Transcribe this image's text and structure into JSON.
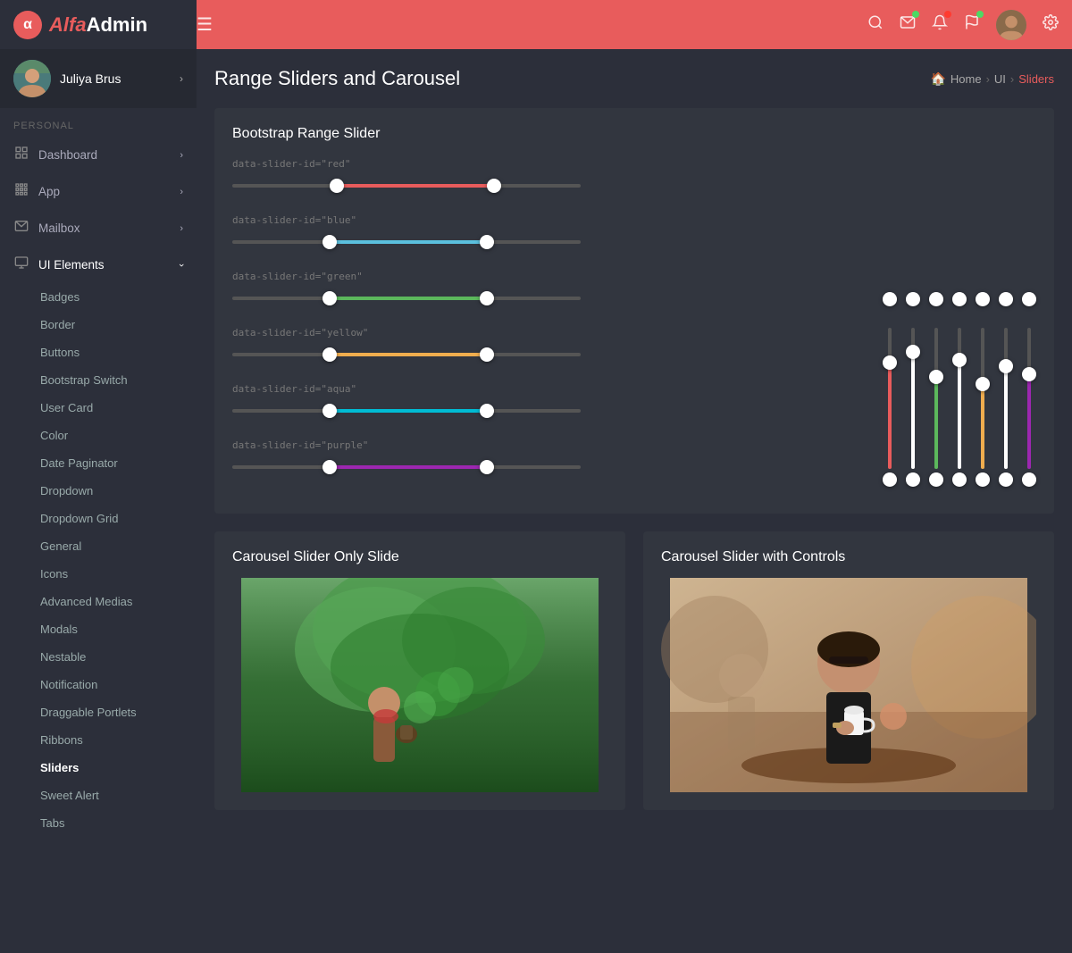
{
  "brand": {
    "alpha": "Alfa",
    "admin": "Admin",
    "logo_letter": "α"
  },
  "navbar": {
    "hamburger": "☰",
    "search_icon": "🔍",
    "mail_icon": "✉",
    "bell_icon": "🔔",
    "flag_icon": "⚑",
    "gear_icon": "⚙"
  },
  "user": {
    "name": "Juliya Brus"
  },
  "sidebar": {
    "section_personal": "PERSONAL",
    "items": [
      {
        "id": "dashboard",
        "label": "Dashboard",
        "icon": "⊞",
        "has_arrow": true
      },
      {
        "id": "app",
        "label": "App",
        "icon": "⊟",
        "has_arrow": true
      },
      {
        "id": "mailbox",
        "label": "Mailbox",
        "icon": "✉",
        "has_arrow": true
      },
      {
        "id": "ui-elements",
        "label": "UI Elements",
        "icon": "▭",
        "has_arrow": true,
        "active": true
      }
    ],
    "sub_items": [
      {
        "id": "badges",
        "label": "Badges"
      },
      {
        "id": "border",
        "label": "Border"
      },
      {
        "id": "buttons",
        "label": "Buttons"
      },
      {
        "id": "bootstrap-switch",
        "label": "Bootstrap Switch"
      },
      {
        "id": "user-card",
        "label": "User Card"
      },
      {
        "id": "color",
        "label": "Color"
      },
      {
        "id": "date-paginator",
        "label": "Date Paginator"
      },
      {
        "id": "dropdown",
        "label": "Dropdown"
      },
      {
        "id": "dropdown-grid",
        "label": "Dropdown Grid"
      },
      {
        "id": "general",
        "label": "General"
      },
      {
        "id": "icons",
        "label": "Icons"
      },
      {
        "id": "advanced-medias",
        "label": "Advanced Medias"
      },
      {
        "id": "modals",
        "label": "Modals"
      },
      {
        "id": "nestable",
        "label": "Nestable"
      },
      {
        "id": "notification",
        "label": "Notification"
      },
      {
        "id": "draggable-portlets",
        "label": "Draggable Portlets"
      },
      {
        "id": "ribbons",
        "label": "Ribbons"
      },
      {
        "id": "sliders",
        "label": "Sliders",
        "active": true
      },
      {
        "id": "sweet-alert",
        "label": "Sweet Alert"
      },
      {
        "id": "tabs",
        "label": "Tabs"
      }
    ]
  },
  "page": {
    "title": "Range Sliders and Carousel",
    "breadcrumb": {
      "home": "Home",
      "section": "UI",
      "current": "Sliders"
    }
  },
  "range_slider_card": {
    "title": "Bootstrap Range Slider",
    "sliders": [
      {
        "id": "red",
        "label": "data-slider-id=\"red\"",
        "color": "#e85c5c",
        "fill_pct": 45,
        "thumb1_pct": 30,
        "thumb2_pct": 75
      },
      {
        "id": "blue",
        "label": "data-slider-id=\"blue\"",
        "color": "#5bc0de",
        "fill_pct": 45,
        "thumb1_pct": 28,
        "thumb2_pct": 73
      },
      {
        "id": "green",
        "label": "data-slider-id=\"green\"",
        "color": "#5cb85c",
        "fill_pct": 45,
        "thumb1_pct": 28,
        "thumb2_pct": 73
      },
      {
        "id": "yellow",
        "label": "data-slider-id=\"yellow\"",
        "color": "#f0ad4e",
        "fill_pct": 45,
        "thumb1_pct": 28,
        "thumb2_pct": 73
      },
      {
        "id": "aqua",
        "label": "data-slider-id=\"aqua\"",
        "color": "#00bcd4",
        "fill_pct": 45,
        "thumb1_pct": 28,
        "thumb2_pct": 73
      },
      {
        "id": "purple",
        "label": "data-slider-id=\"purple\"",
        "color": "#9c27b0",
        "fill_pct": 45,
        "thumb1_pct": 28,
        "thumb2_pct": 73
      }
    ],
    "vertical_sliders": [
      {
        "id": "v-red",
        "color": "#e85c5c",
        "top_pct": 20,
        "fill_pct": 80
      },
      {
        "id": "v-white1",
        "color": "#fff",
        "top_pct": 15,
        "fill_pct": 85
      },
      {
        "id": "v-green",
        "color": "#5cb85c",
        "top_pct": 25,
        "fill_pct": 75
      },
      {
        "id": "v-white2",
        "color": "#fff",
        "top_pct": 18,
        "fill_pct": 82
      },
      {
        "id": "v-yellow",
        "color": "#f0ad4e",
        "top_pct": 30,
        "fill_pct": 70
      },
      {
        "id": "v-white3",
        "color": "#fff",
        "top_pct": 22,
        "fill_pct": 78
      },
      {
        "id": "v-purple",
        "color": "#9c27b0",
        "top_pct": 25,
        "fill_pct": 75
      }
    ]
  },
  "carousel_only": {
    "title": "Carousel Slider Only Slide"
  },
  "carousel_controls": {
    "title": "Carousel Slider with Controls"
  }
}
